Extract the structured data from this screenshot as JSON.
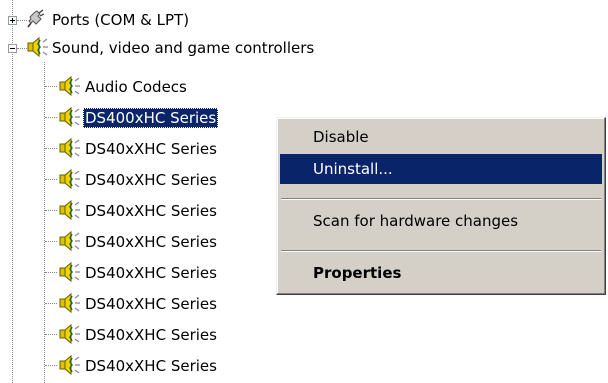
{
  "tree": {
    "ports": {
      "label": "Ports (COM & LPT)",
      "icon": "port-connector-icon"
    },
    "sound": {
      "label": "Sound, video and game controllers",
      "icon": "speaker-icon"
    },
    "children": [
      {
        "label": "Audio Codecs",
        "icon": "speaker-icon"
      },
      {
        "label": "DS400xHC Series",
        "icon": "speaker-icon",
        "selected": true
      },
      {
        "label": "DS40xXHC Series",
        "icon": "speaker-icon"
      },
      {
        "label": "DS40xXHC Series",
        "icon": "speaker-icon"
      },
      {
        "label": "DS40xXHC Series",
        "icon": "speaker-icon"
      },
      {
        "label": "DS40xXHC Series",
        "icon": "speaker-icon"
      },
      {
        "label": "DS40xXHC Series",
        "icon": "speaker-icon"
      },
      {
        "label": "DS40xXHC Series",
        "icon": "speaker-icon"
      },
      {
        "label": "DS40xXHC Series",
        "icon": "speaker-icon"
      },
      {
        "label": "DS40xXHC Series",
        "icon": "speaker-icon"
      }
    ]
  },
  "context_menu": {
    "items": [
      {
        "label": "Disable"
      },
      {
        "label": "Uninstall...",
        "highlighted": true
      },
      {
        "label": "Scan for hardware changes"
      },
      {
        "label": "Properties",
        "bold": true
      }
    ]
  },
  "colors": {
    "selection": "#0a246a",
    "menu_face": "#d4d0c8"
  }
}
